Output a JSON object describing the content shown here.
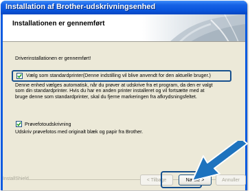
{
  "window": {
    "title": "Installation af Brother-udskrivningsenhed"
  },
  "header": {
    "title": "Installationen er gennemført"
  },
  "body": {
    "done_text": "Driverinstallationen er gennemført!",
    "default_printer": {
      "checked": true,
      "label": "Vælg som standardprinter(Denne indstilling vil blive anvendt for den aktuelle bruger.)"
    },
    "default_desc_lines": [
      "Denne enhed vælges automatisk, når du prøver at udskrive fra et program, da den er valgt",
      "som din standardprinter. Hvis du har en anden printer installeret og vil fortsætte med at",
      "bruge denne som standardprinter, skal du fjerne markeringen fra afkrydsningsfeltet."
    ],
    "test_print": {
      "checked": true,
      "label": "Prøvefotoudskrivning"
    },
    "test_print_desc": "Udskriv prøvefotos med originalt blæk og papir fra Brother."
  },
  "footer": {
    "installshield_label": "InstallShield",
    "back_label": "< Tilbage",
    "next_label": "Næste >",
    "cancel_label": "Annuller"
  },
  "colors": {
    "title_bar": "#0b5be0",
    "dialog_bg": "#ece9d8",
    "highlight_border": "#16508e",
    "arrow": "#1e73be"
  }
}
